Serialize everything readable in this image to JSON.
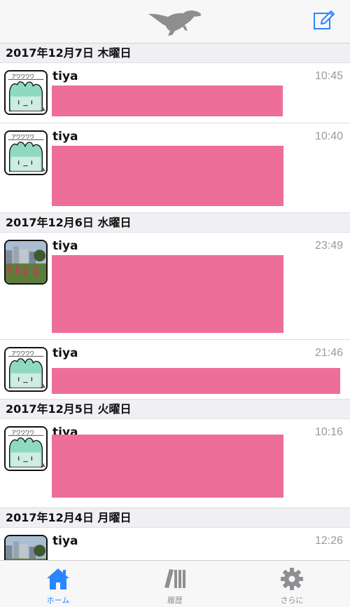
{
  "navbar": {
    "logo_icon": "dinosaur-icon",
    "compose_icon": "compose-icon",
    "accent": "#2a86ff"
  },
  "sections": [
    {
      "date": "2017年12月7日 木曜日",
      "posts": [
        {
          "author": "tiya",
          "time": "10:45",
          "avatar": "cat-avatar"
        },
        {
          "author": "tiya",
          "time": "10:40",
          "avatar": "cat-avatar"
        }
      ]
    },
    {
      "date": "2017年12月6日 水曜日",
      "posts": [
        {
          "author": "tiya",
          "time": "23:49",
          "avatar": "photo-avatar"
        },
        {
          "author": "tiya",
          "time": "21:46",
          "avatar": "cat-avatar"
        }
      ]
    },
    {
      "date": "2017年12月5日 火曜日",
      "posts": [
        {
          "author": "tiya",
          "time": "10:16",
          "avatar": "cat-avatar"
        }
      ]
    },
    {
      "date": "2017年12月4日 月曜日",
      "posts": [
        {
          "author": "tiya",
          "time": "12:26",
          "avatar": "photo-avatar"
        }
      ]
    }
  ],
  "avatar_text": "アワワワワ",
  "media_color": "#ee6e9a",
  "tabs": [
    {
      "label": "ホーム",
      "icon": "home-icon",
      "active": true
    },
    {
      "label": "履歴",
      "icon": "books-icon",
      "active": false
    },
    {
      "label": "さらに",
      "icon": "gear-icon",
      "active": false
    }
  ]
}
